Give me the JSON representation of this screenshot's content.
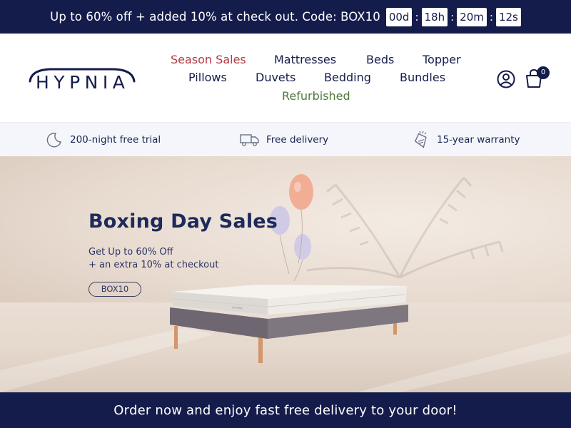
{
  "announcement": {
    "text": "Up to 60% off + added 10% at check out. Code: BOX10",
    "countdown": {
      "days": "00d",
      "hours": "18h",
      "minutes": "20m",
      "seconds": "12s",
      "separator": ":"
    }
  },
  "header": {
    "logo_text": "HYPNIA",
    "nav": {
      "season_sales": "Season Sales",
      "mattresses": "Mattresses",
      "beds": "Beds",
      "topper": "Topper",
      "pillows": "Pillows",
      "duvets": "Duvets",
      "bedding": "Bedding",
      "bundles": "Bundles",
      "refurbished": "Refurbished"
    },
    "cart_count": "0"
  },
  "usp": {
    "trial": "200-night free trial",
    "delivery": "Free delivery",
    "warranty": "15-year warranty"
  },
  "hero": {
    "title": "Boxing Day Sales",
    "subtitle_line1": "Get Up to 60% Off",
    "subtitle_line2": "+ an extra 10% at checkout",
    "code": "BOX10",
    "mattress_label": "HYPNIA"
  },
  "footer_bar": {
    "text": "Order now and enjoy fast free delivery to your door!"
  },
  "colors": {
    "navy": "#141c4c",
    "sale_red": "#b23a44",
    "refurb_green": "#4b7a3c",
    "usp_bg": "#f4f6fb"
  }
}
